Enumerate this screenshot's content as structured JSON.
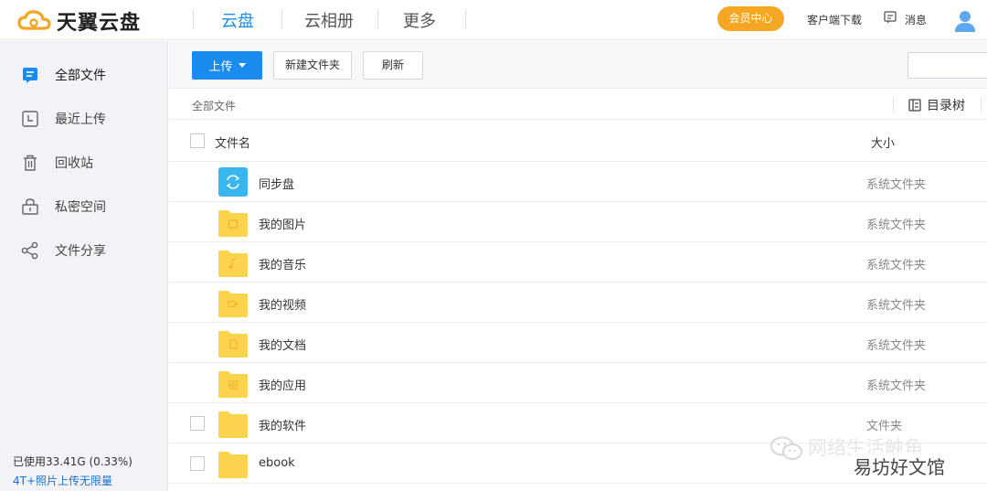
{
  "header": {
    "logo_text": "天翼云盘",
    "tabs": [
      {
        "label": "云盘",
        "active": true
      },
      {
        "label": "云相册",
        "active": false
      },
      {
        "label": "更多",
        "active": false
      }
    ],
    "vip_label": "会员中心",
    "client_download": "客户端下载",
    "messages": "消息"
  },
  "sidebar": {
    "items": [
      {
        "label": "全部文件",
        "icon": "file-list-icon"
      },
      {
        "label": "最近上传",
        "icon": "clock-icon"
      },
      {
        "label": "回收站",
        "icon": "trash-icon"
      },
      {
        "label": "私密空间",
        "icon": "lock-icon"
      },
      {
        "label": "文件分享",
        "icon": "share-icon"
      }
    ],
    "usage": "已使用33.41G (0.33%)",
    "promo": "4T+照片上传无限量"
  },
  "toolbar": {
    "upload": "上传",
    "new_folder": "新建文件夹",
    "refresh": "刷新",
    "search_placeholder": ""
  },
  "breadcrumb": "全部文件",
  "tree_label": "目录树",
  "table": {
    "col_name": "文件名",
    "col_size": "大小",
    "rows": [
      {
        "name": "同步盘",
        "type": "系统文件夹",
        "icon": "sync-folder-icon",
        "checkbox": false
      },
      {
        "name": "我的图片",
        "type": "系统文件夹",
        "icon": "image-folder-icon",
        "checkbox": false
      },
      {
        "name": "我的音乐",
        "type": "系统文件夹",
        "icon": "music-folder-icon",
        "checkbox": false
      },
      {
        "name": "我的视频",
        "type": "系统文件夹",
        "icon": "video-folder-icon",
        "checkbox": false
      },
      {
        "name": "我的文档",
        "type": "系统文件夹",
        "icon": "document-folder-icon",
        "checkbox": false
      },
      {
        "name": "我的应用",
        "type": "系统文件夹",
        "icon": "app-folder-icon",
        "checkbox": false
      },
      {
        "name": "我的软件",
        "type": "文件夹",
        "icon": "folder-icon",
        "checkbox": true
      },
      {
        "name": "ebook",
        "type": "",
        "icon": "folder-icon",
        "checkbox": true
      }
    ]
  },
  "watermark": {
    "line1": "网络生活触角",
    "line2": "易坊好文馆"
  },
  "colors": {
    "accent": "#1a8cf0",
    "vip": "#f5a623",
    "folder": "#fcd34d",
    "sync": "#38b6f0"
  }
}
